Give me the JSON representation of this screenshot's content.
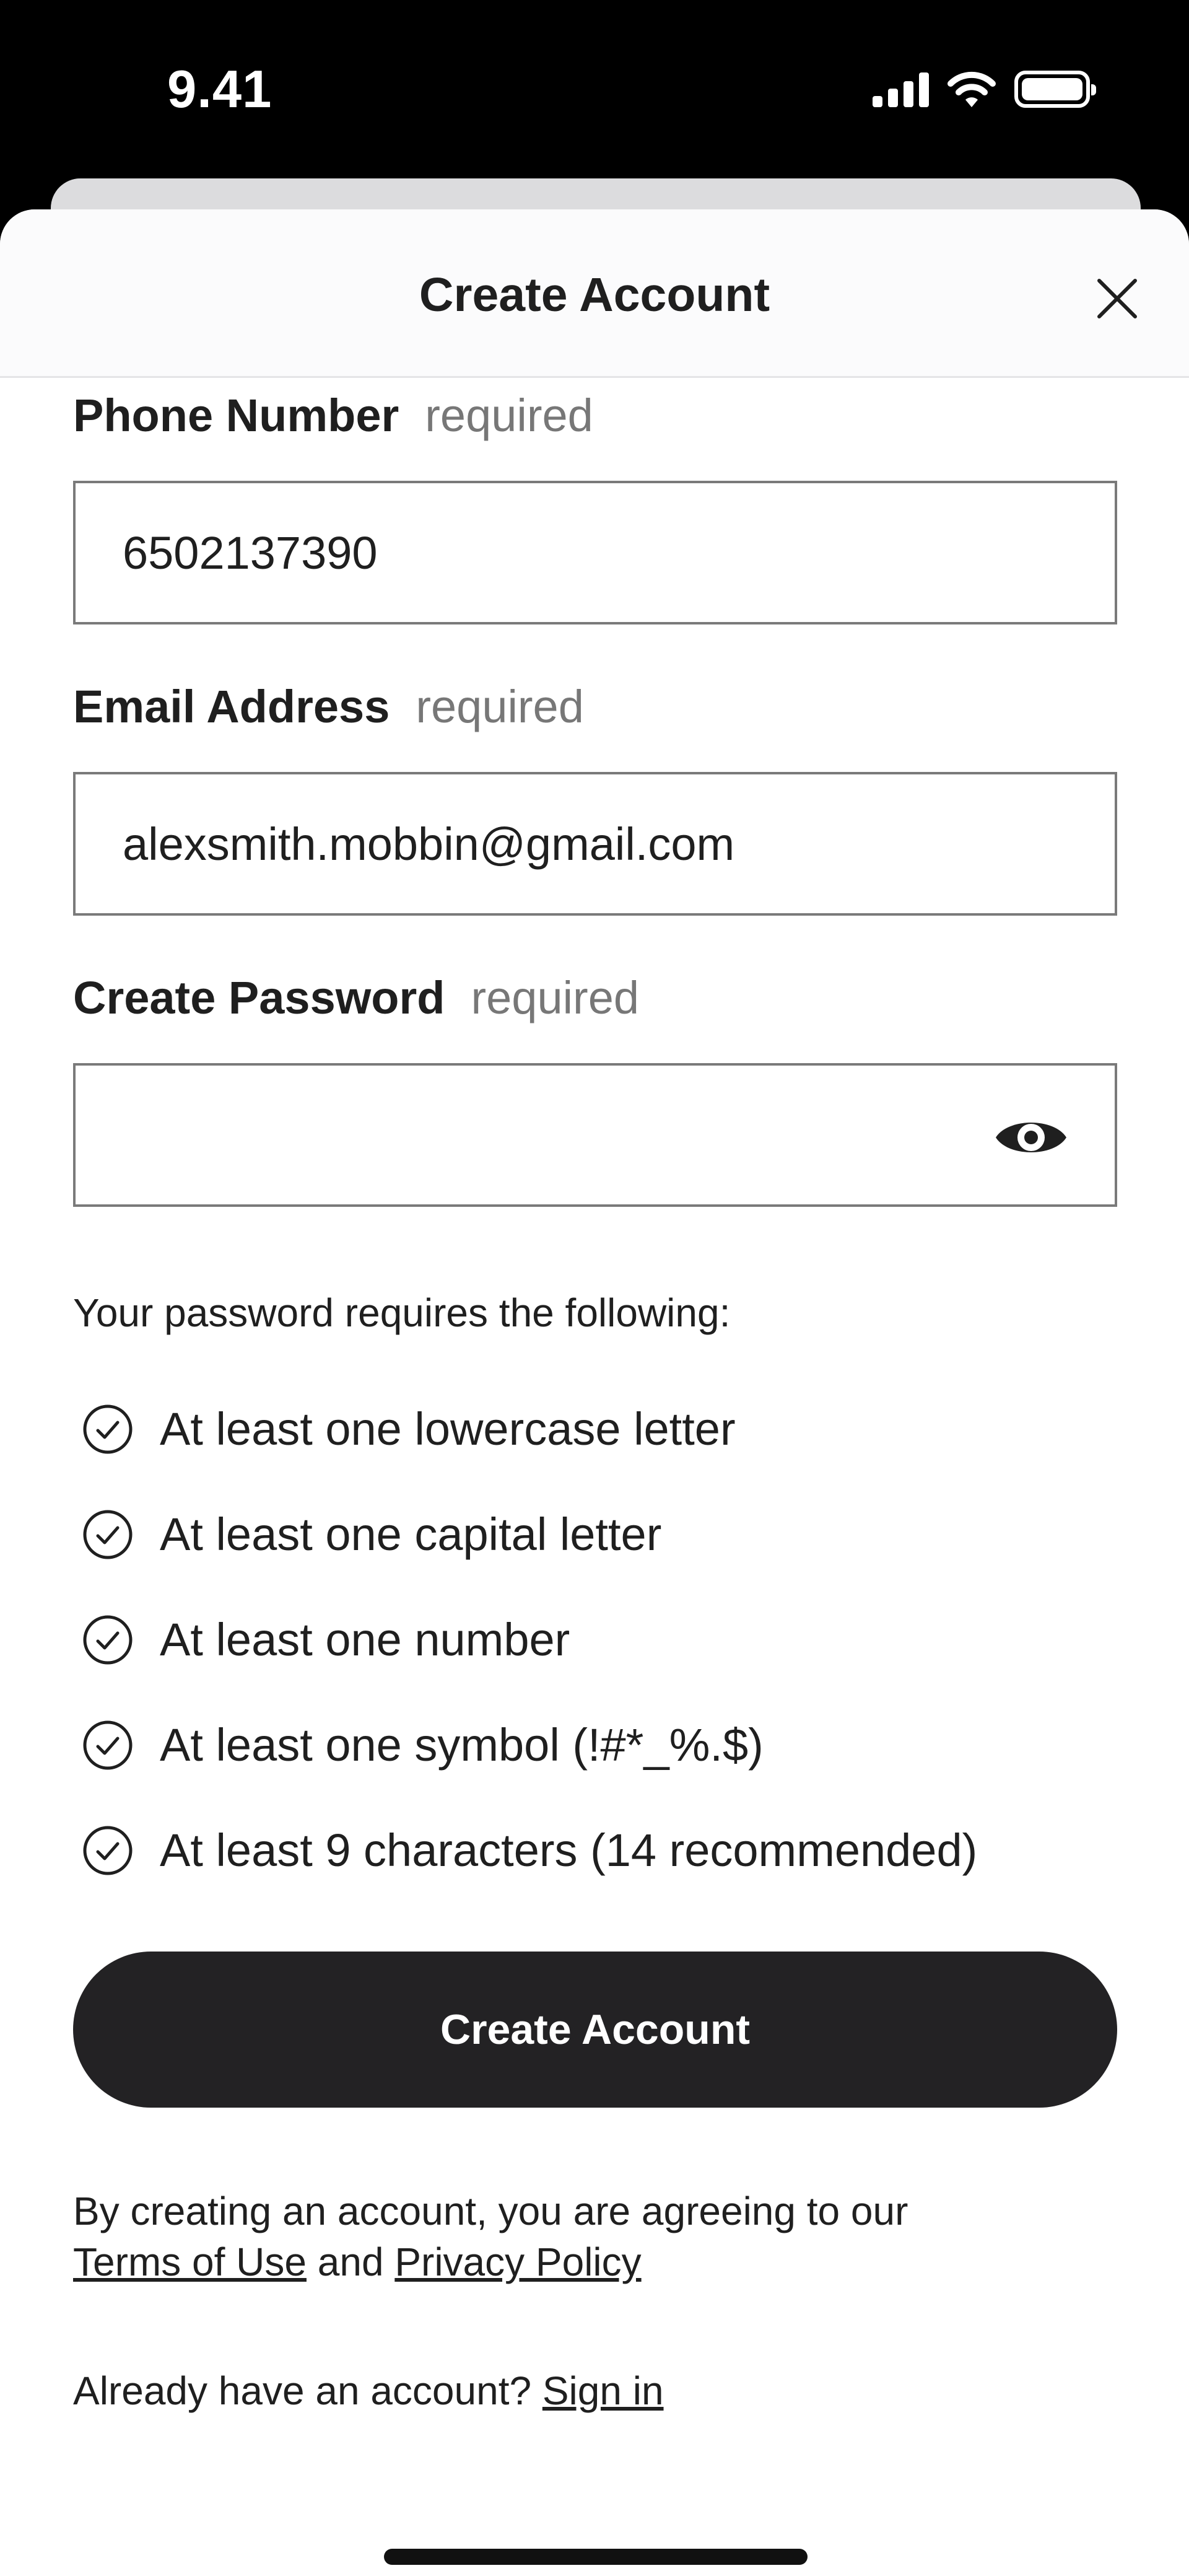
{
  "status": {
    "time": "9.41"
  },
  "header": {
    "title": "Create Account"
  },
  "form": {
    "phone": {
      "label": "Phone Number",
      "required": "required",
      "value": "6502137390"
    },
    "email": {
      "label": "Email Address",
      "required": "required",
      "value": "alexsmith.mobbin@gmail.com"
    },
    "password": {
      "label": "Create Password",
      "required": "required",
      "value": ""
    }
  },
  "requirements": {
    "title": "Your password requires the following:",
    "items": [
      "At least one lowercase letter",
      "At least one capital letter",
      "At least one number",
      "At least one symbol (!#*_%.$)",
      "At least 9 characters (14 recommended)"
    ]
  },
  "actions": {
    "create_label": "Create Account"
  },
  "legal": {
    "prefix": "By creating an account, you are agreeing to our",
    "terms": "Terms of Use",
    "and": "and",
    "privacy": "Privacy Policy"
  },
  "signin": {
    "prompt": "Already have an account?",
    "link": "Sign in"
  },
  "icons": {
    "close": "close-icon",
    "eye": "eye-icon",
    "check": "check-circle-icon"
  }
}
